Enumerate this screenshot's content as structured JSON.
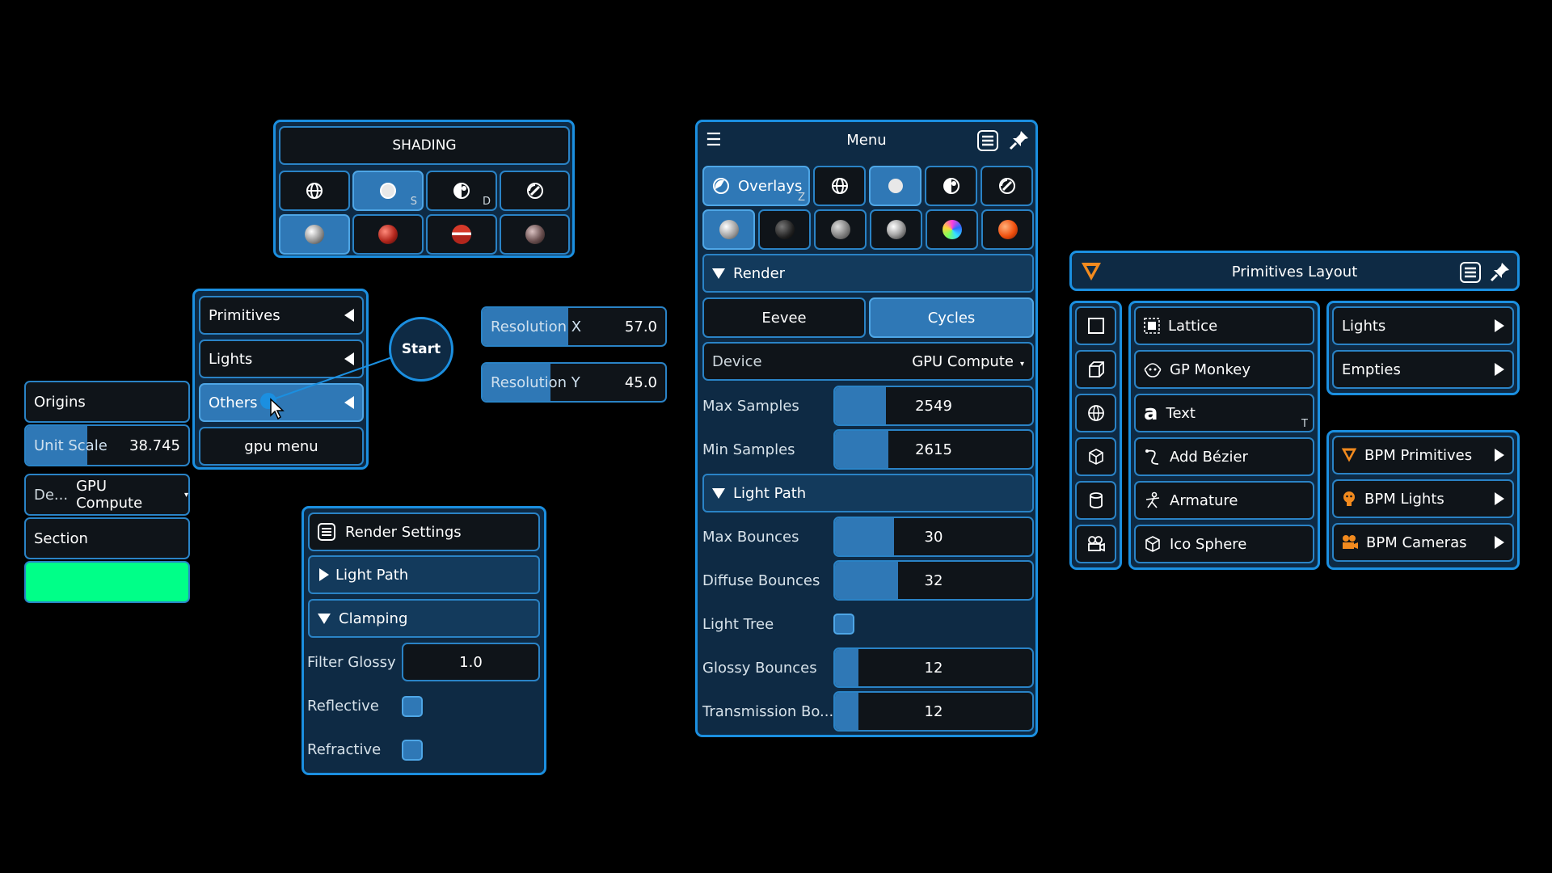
{
  "shading": {
    "title": "SHADING",
    "modes": [
      {
        "icon": "wireframe-globe-icon",
        "hotkey": ""
      },
      {
        "icon": "solid-circle-icon",
        "hotkey": "S"
      },
      {
        "icon": "material-preview-icon",
        "hotkey": "D"
      },
      {
        "icon": "rendered-icon",
        "hotkey": ""
      }
    ]
  },
  "pie_menu": {
    "items": [
      "Primitives",
      "Lights",
      "Others",
      "gpu menu"
    ],
    "start": "Start"
  },
  "resolution": {
    "x_label": "Resolution X",
    "x_value": "57.0",
    "x_fill": 0.57,
    "y_label": "Resolution Y",
    "y_value": "45.0",
    "y_fill": 0.45
  },
  "left_panel": {
    "origins": "Origins",
    "unit_scale_label": "Unit Scale",
    "unit_scale_value": "38.745",
    "device_label": "De...",
    "device_value": "GPU Compute",
    "section": "Section",
    "color_swatch": "#00ff88"
  },
  "render_settings": {
    "title": "Render Settings",
    "light_path": "Light Path",
    "clamping": "Clamping",
    "filter_glossy_label": "Filter Glossy",
    "filter_glossy_value": "1.0",
    "reflective": "Reflective",
    "refractive": "Refractive"
  },
  "menu": {
    "title": "Menu",
    "overlays": "Overlays",
    "overlays_hotkey": "Z",
    "render": "Render",
    "eevee": "Eevee",
    "cycles": "Cycles",
    "device_label": "Device",
    "device_value": "GPU Compute",
    "max_samples_label": "Max Samples",
    "max_samples_value": "2549",
    "max_samples_fill": 0.26,
    "min_samples_label": "Min Samples",
    "min_samples_value": "2615",
    "min_samples_fill": 0.27,
    "light_path": "Light Path",
    "max_bounces_label": "Max Bounces",
    "max_bounces_value": "30",
    "max_bounces_fill": 0.3,
    "diffuse_bounces_label": "Diffuse Bounces",
    "diffuse_bounces_value": "32",
    "diffuse_bounces_fill": 0.32,
    "light_tree_label": "Light Tree",
    "glossy_bounces_label": "Glossy Bounces",
    "glossy_bounces_value": "12",
    "glossy_bounces_fill": 0.12,
    "transmission_label": "Transmission Bo...",
    "transmission_value": "12",
    "transmission_fill": 0.12
  },
  "primitives_layout": {
    "title": "Primitives Layout",
    "items": [
      {
        "label": "Lattice",
        "icon": "lattice-icon",
        "hotkey": ""
      },
      {
        "label": "GP Monkey",
        "icon": "monkey-icon",
        "hotkey": ""
      },
      {
        "label": "Text",
        "icon": "text-icon",
        "hotkey": "T"
      },
      {
        "label": "Add Bézier",
        "icon": "bezier-icon",
        "hotkey": ""
      },
      {
        "label": "Armature",
        "icon": "armature-icon",
        "hotkey": ""
      },
      {
        "label": "Ico Sphere",
        "icon": "ico-sphere-icon",
        "hotkey": ""
      }
    ],
    "menus": [
      "Lights",
      "Empties"
    ],
    "bpm": [
      "BPM Primitives",
      "BPM Lights",
      "BPM Cameras"
    ],
    "text_glyph": "a"
  },
  "colors": {
    "accent": "#1b8fe0",
    "selected": "#2f78b6",
    "panel_bg": "#0e2a44",
    "field_bg": "#0f1419"
  }
}
